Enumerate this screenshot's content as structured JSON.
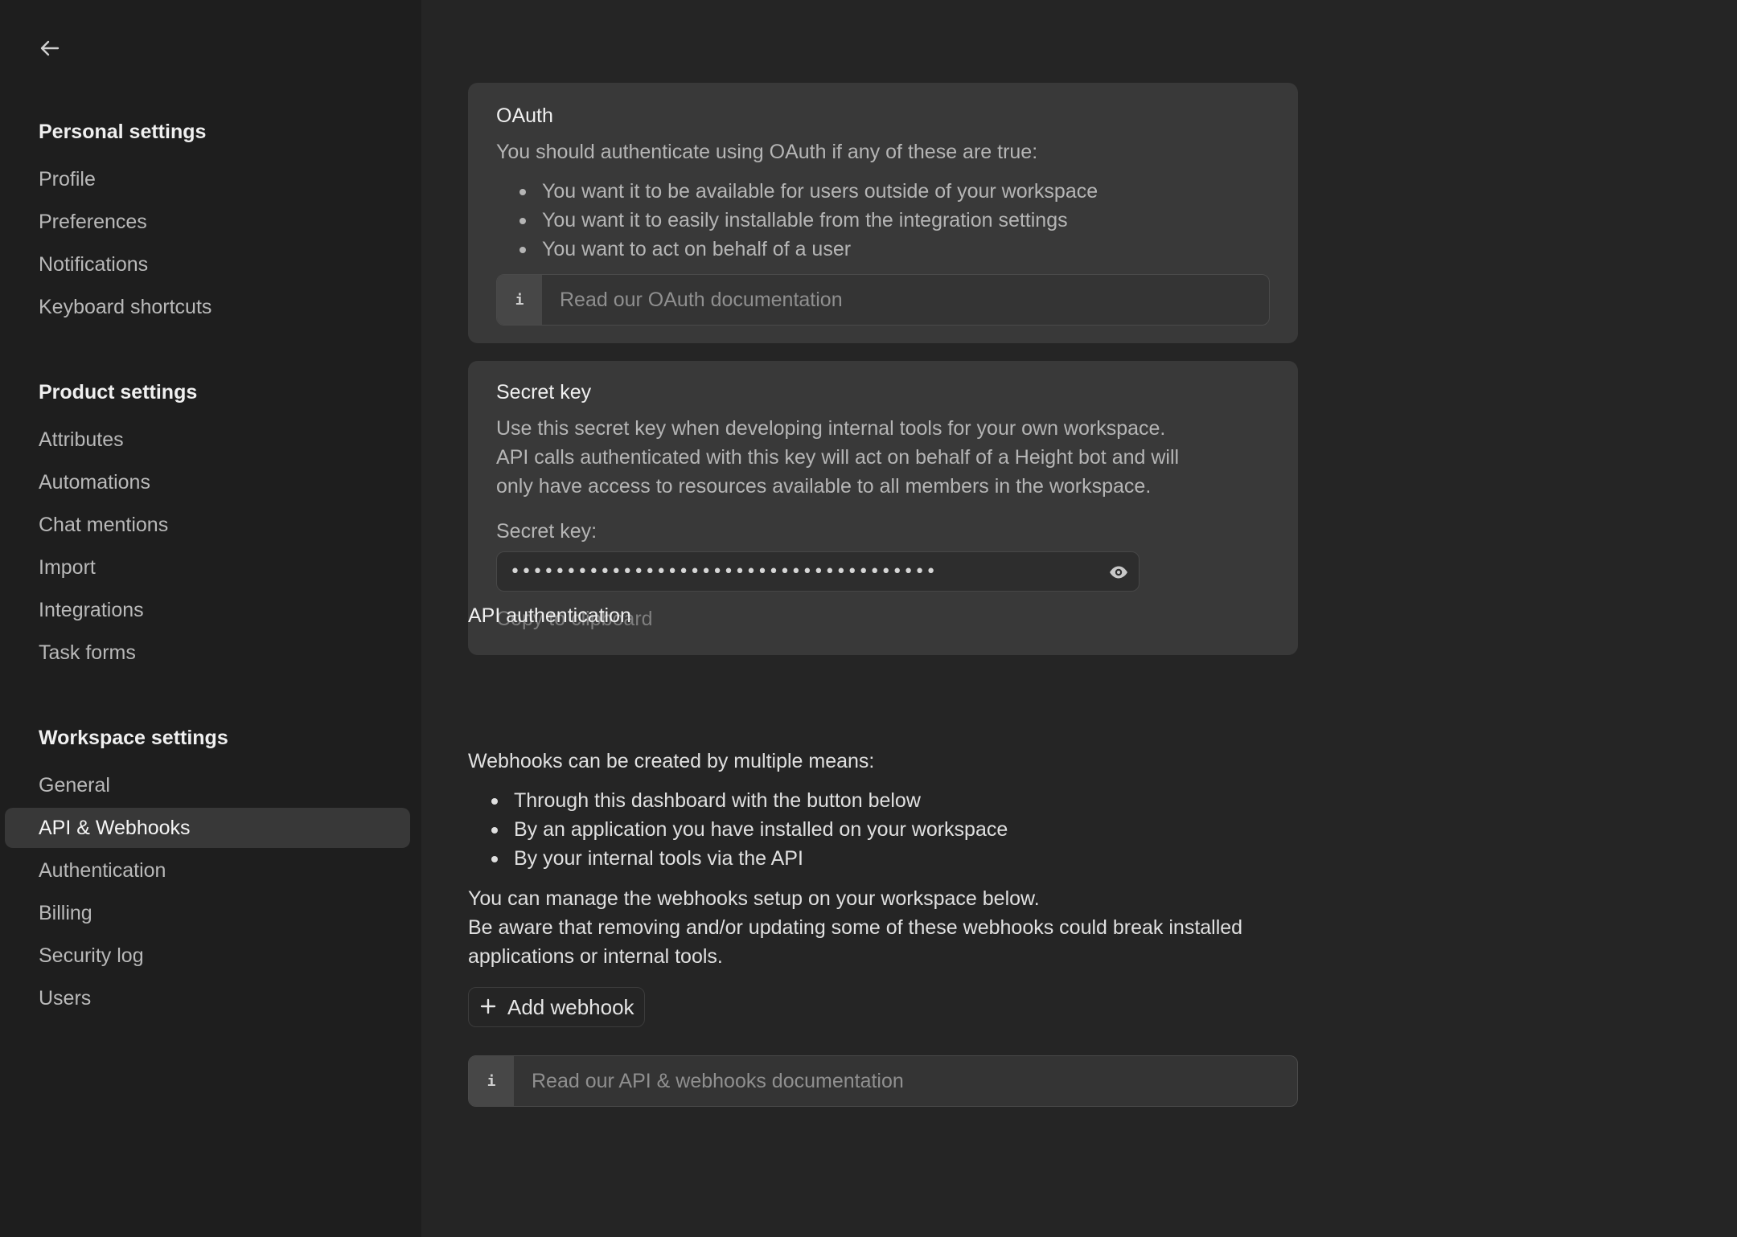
{
  "sidebar": {
    "sections": [
      {
        "title": "Personal settings",
        "items": [
          "Profile",
          "Preferences",
          "Notifications",
          "Keyboard shortcuts"
        ]
      },
      {
        "title": "Product settings",
        "items": [
          "Attributes",
          "Automations",
          "Chat mentions",
          "Import",
          "Integrations",
          "Task forms"
        ]
      },
      {
        "title": "Workspace settings",
        "items": [
          "General",
          "API & Webhooks",
          "Authentication",
          "Billing",
          "Security log",
          "Users"
        ]
      }
    ],
    "active_item": "API & Webhooks"
  },
  "oauth": {
    "title": "OAuth",
    "intro": "You should authenticate using OAuth if any of these are true:",
    "bullets": [
      "You want it to be available for users outside of your workspace",
      "You want it to easily installable from the integration settings",
      "You want to act on behalf of a user"
    ],
    "doc_link": "Read our OAuth documentation"
  },
  "secret": {
    "title": "Secret key",
    "description_lines": [
      "Use this secret key when developing internal tools for your own workspace.",
      "API calls authenticated with this key will act on behalf of a Height bot and will",
      "only have access to resources available to all members in the workspace."
    ],
    "field_label": "Secret key:",
    "masked_value": "••••••••••••••••••••••••••••••••••••••",
    "copy_label": "Copy to clipboard",
    "overlay_heading": "API authentication"
  },
  "webhooks": {
    "intro": "Webhooks can be created by multiple means:",
    "bullets": [
      "Through this dashboard with the button below",
      "By an application you have installed on your workspace",
      "By your internal tools via the API"
    ],
    "manage_lines": [
      "You can manage the webhooks setup on your workspace below.",
      "Be aware that removing and/or updating some of these webhooks could break installed",
      "applications or internal tools."
    ],
    "add_button": "Add webhook",
    "doc_link": "Read our API & webhooks documentation"
  },
  "icons": {
    "back": "arrow-left-icon",
    "info": "info-icon",
    "eye": "eye-icon",
    "plus": "plus-icon"
  }
}
